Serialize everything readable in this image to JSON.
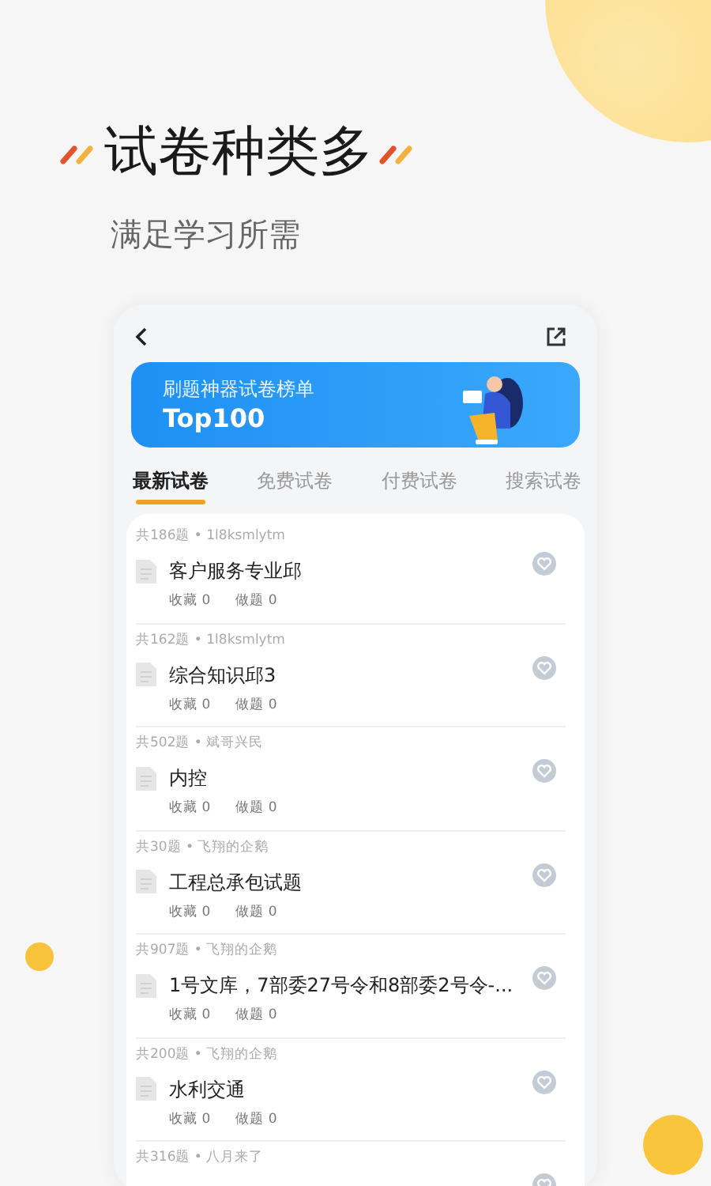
{
  "headline": {
    "title": "试卷种类多",
    "subtitle": "满足学习所需"
  },
  "banner": {
    "caption": "刷题神器试卷榜单",
    "title": "Top100"
  },
  "tabs": [
    {
      "label": "最新试卷",
      "selected": true
    },
    {
      "label": "免费试卷",
      "selected": false
    },
    {
      "label": "付费试卷",
      "selected": false
    },
    {
      "label": "搜索试卷",
      "selected": false
    }
  ],
  "papers": [
    {
      "meta": "共186题 • 1l8ksmlytm",
      "title": "客户服务专业邱",
      "stats": [
        "收藏 0",
        "做题 0"
      ],
      "favorited": false
    },
    {
      "meta": "共162题 • 1l8ksmlytm",
      "title": "综合知识邱3",
      "stats": [
        "收藏 0",
        "做题 0"
      ],
      "favorited": false
    },
    {
      "meta": "共502题 • 斌哥兴民",
      "title": "内控",
      "stats": [
        "收藏 0",
        "做题 0"
      ],
      "favorited": false
    },
    {
      "meta": "共30题 • 飞翔的企鹅",
      "title": "工程总承包试题",
      "stats": [
        "收藏 0",
        "做题 0"
      ],
      "favorited": false
    },
    {
      "meta": "共907题 • 飞翔的企鹅",
      "title": "1号文库，7部委27号令和8部委2号令-...",
      "stats": [
        "收藏 0",
        "做题 0"
      ],
      "favorited": false
    },
    {
      "meta": "共200题 • 飞翔的企鹅",
      "title": "水利交通",
      "stats": [
        "收藏 0",
        "做题 0"
      ],
      "favorited": false
    },
    {
      "meta": "共316题 • 八月来了",
      "favorited": false
    }
  ]
}
